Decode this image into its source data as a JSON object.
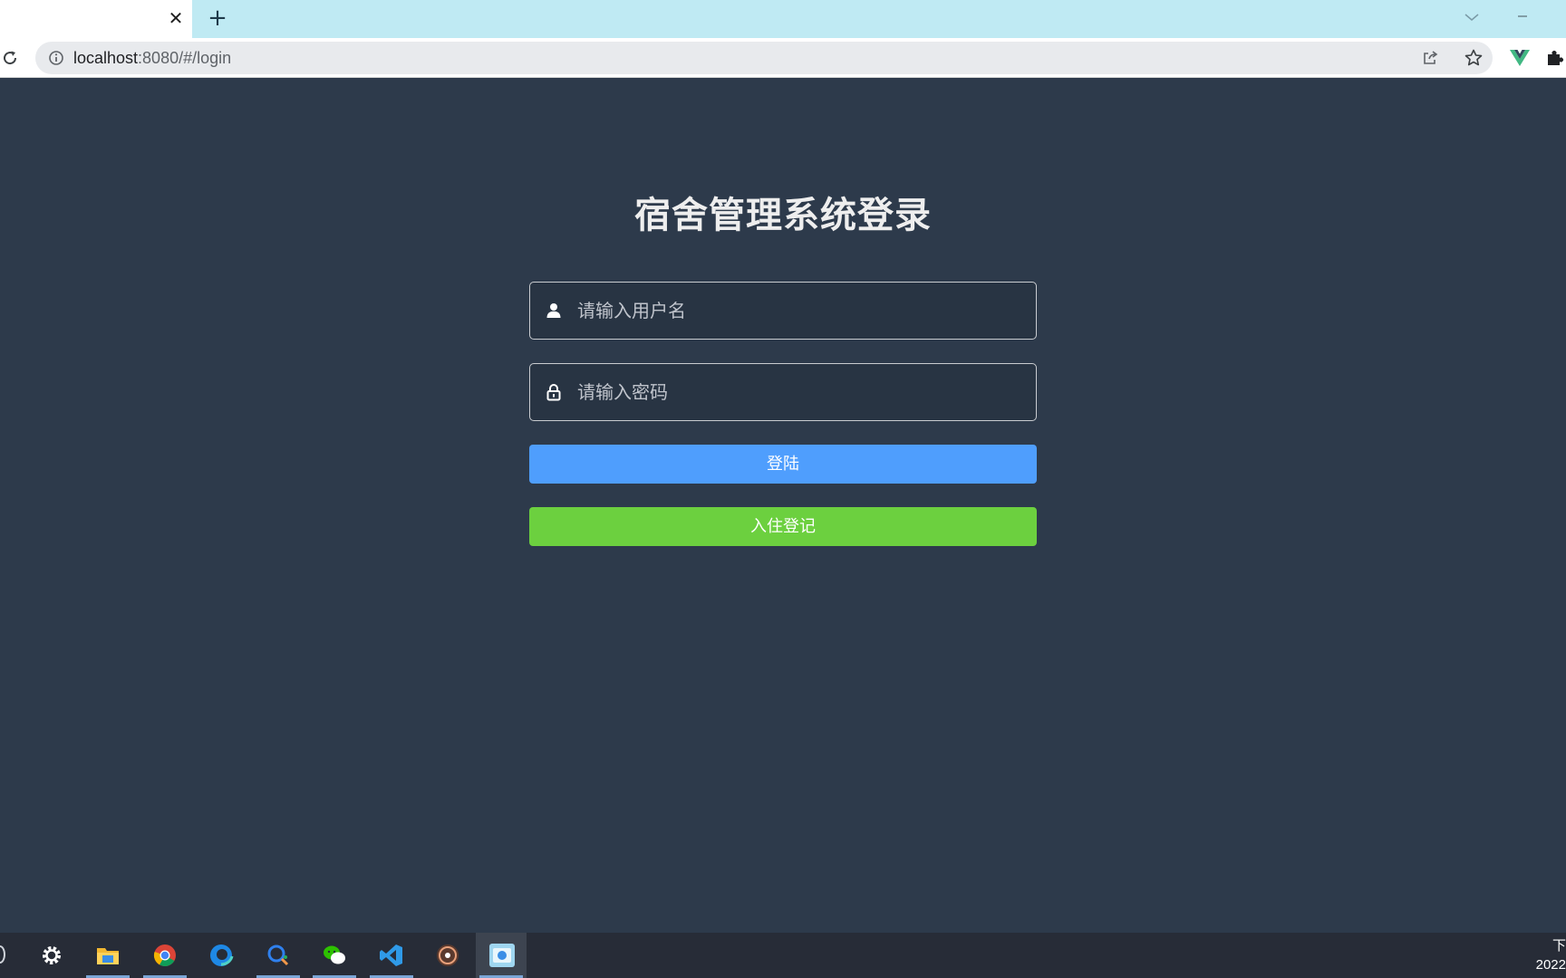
{
  "browser": {
    "tab": {
      "close_glyph": "✕"
    },
    "new_tab_glyph": "+",
    "address": {
      "host": "localhost",
      "rest": ":8080/#/login"
    },
    "icons": {
      "reload": "reload-icon",
      "info": "info-icon",
      "share": "share-icon",
      "bookmark": "star-icon",
      "vue_devtools": "vue-icon",
      "extensions": "puzzle-icon",
      "tab_search": "chevron-down-icon",
      "minimize": "minimize-icon"
    }
  },
  "login": {
    "title": "宿舍管理系统登录",
    "username": {
      "placeholder": "请输入用户名",
      "value": "",
      "icon": "user-icon"
    },
    "password": {
      "placeholder": "请输入密码",
      "value": "",
      "icon": "lock-icon"
    },
    "login_button": "登陆",
    "register_button": "入住登记",
    "colors": {
      "background": "#2d3a4b",
      "login_button": "#4f9efd",
      "register_button": "#6cd03f"
    }
  },
  "taskbar": {
    "apps": [
      "settings-icon",
      "file-explorer-icon",
      "chrome-icon",
      "edge-icon",
      "search-app-icon",
      "wechat-icon",
      "vscode-icon",
      "media-player-icon",
      "active-app-icon"
    ],
    "clock": {
      "line1": "下",
      "line2": "2022"
    }
  }
}
